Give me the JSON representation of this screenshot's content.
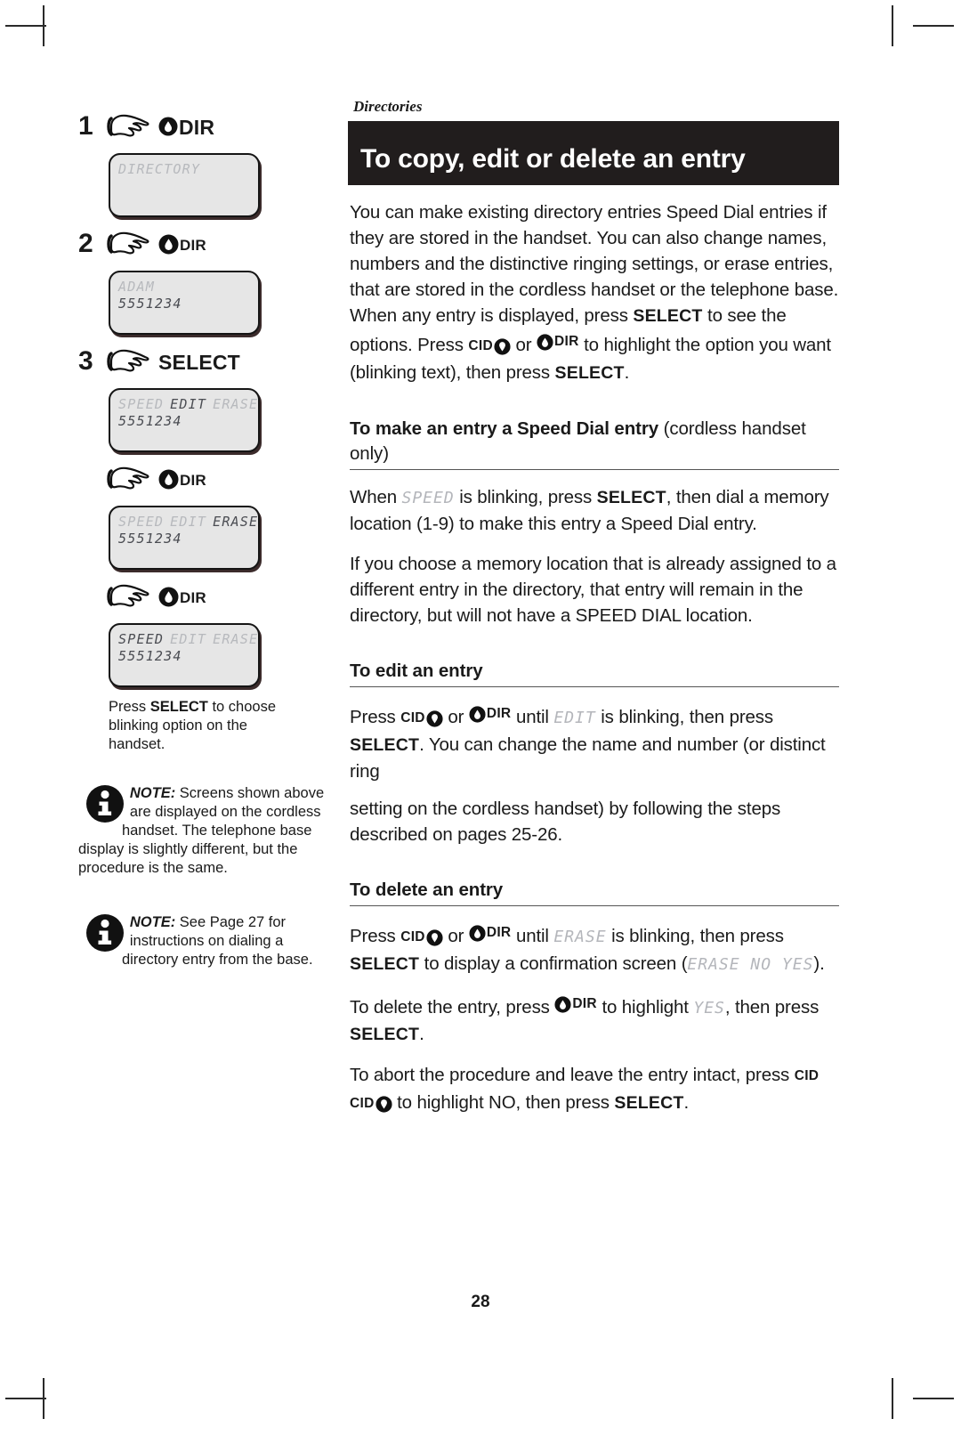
{
  "page": {
    "number": "28",
    "eyebrow": "Directories",
    "title": "To copy, edit or delete an entry"
  },
  "left_column": {
    "steps": [
      {
        "number": "1",
        "key_label": "DIR",
        "key_badge": "up-arrow-badge",
        "badge_size": "large",
        "screen": {
          "lines": [
            "DIRECTORY"
          ]
        }
      },
      {
        "number": "2",
        "key_label": "DIR",
        "key_badge": "up-arrow-badge",
        "badge_size": "small",
        "screen": {
          "lines": [
            "ADAM",
            "5551234"
          ]
        }
      },
      {
        "number": "3",
        "key_label": "SELECT",
        "key_badge": "none",
        "badge_size": "none",
        "screen": {
          "options": [
            "SPEED",
            "EDIT",
            "ERASE"
          ],
          "highlighted": "EDIT",
          "number_line": "5551234"
        }
      },
      {
        "number": "",
        "key_label": "DIR",
        "key_badge": "up-arrow-badge",
        "badge_size": "small",
        "screen": {
          "options": [
            "SPEED",
            "EDIT",
            "ERASE"
          ],
          "highlighted": "ERASE",
          "number_line": "5551234"
        }
      },
      {
        "number": "",
        "key_label": "DIR",
        "key_badge": "up-arrow-badge",
        "badge_size": "small",
        "screen": {
          "options": [
            "SPEED",
            "EDIT",
            "ERASE"
          ],
          "highlighted": "SPEED",
          "number_line": "5551234"
        }
      }
    ],
    "caption": {
      "pre": "Press ",
      "bold": "SELECT",
      "post": " to choose blinking option on the handset."
    },
    "notes": [
      {
        "lead": "NOTE:",
        "text": " Screens shown above are displayed on the cordless handset. The telephone base display is slightly different, but the procedure is the same."
      },
      {
        "lead": "NOTE:",
        "text": " See Page 27 for instructions on dialing a directory entry from the base."
      }
    ]
  },
  "right_column": {
    "intro": {
      "p1_a": "You can make existing directory entries Speed Dial entries if they are stored in the handset. You can also change names, numbers and the distinctive ringing settings, or erase entries, that are stored in the cordless handset or the telephone base. When any entry is displayed, press ",
      "p1_select1": "SELECT",
      "p1_b": " to see the options. Press ",
      "p1_cid": "CID",
      "p1_c": " or ",
      "p1_dir": "DIR",
      "p1_d": " to highlight the option you want (blinking text), then press ",
      "p1_select2": "SELECT",
      "p1_e": "."
    },
    "section_speed": {
      "heading_bold": "To make an entry a Speed Dial entry",
      "heading_light": " (cordless handset only)",
      "p1_a": "When ",
      "p1_seg": "SPEED",
      "p1_b": " is blinking, press ",
      "p1_select": "SELECT",
      "p1_c": ", then dial a memory location (1-9) to make this entry a Speed Dial entry.",
      "p2": "If you choose a memory location that is already assigned to a different entry in the directory, that entry will remain in the directory, but will not have a SPEED DIAL location."
    },
    "section_edit": {
      "heading": "To edit an entry",
      "p1_a": "Press ",
      "p1_cid": "CID",
      "p1_b": " or ",
      "p1_dir": "DIR",
      "p1_c": " until ",
      "p1_seg": "EDIT",
      "p1_d": " is blinking, then press ",
      "p1_select": "SELECT",
      "p1_e": ". You can change the name and number (or distinct ring",
      "p2": "setting on the cordless handset) by following the steps described on pages 25-26."
    },
    "section_delete": {
      "heading": "To delete an entry",
      "p1_a": "Press ",
      "p1_cid": "CID",
      "p1_b": " or ",
      "p1_dir": "DIR",
      "p1_c": " until ",
      "p1_seg": "ERASE",
      "p1_d": " is blinking, then press ",
      "p1_select": "SELECT",
      "p1_e": " to display a confirmation screen (",
      "p1_seg2": "ERASE NO YES",
      "p1_f": ").",
      "p2_a": "To delete the entry, press ",
      "p2_dir": "DIR",
      "p2_b": " to highlight ",
      "p2_seg": "YES",
      "p2_c": ", then press ",
      "p2_select": "SELECT",
      "p2_d": ".",
      "p3_a": "To abort the procedure and leave the entry intact, press ",
      "p3_cid1": "CID",
      "p3_cid2": "CID",
      "p3_b": " to highlight NO, then press ",
      "p3_select": "SELECT",
      "p3_c": "."
    }
  },
  "colors": {
    "title_bar_bg": "#211d1d",
    "lcd_bg": "#e6e6e6",
    "segment_dim": "#b7b9bd",
    "segment_on": "#4a4c52"
  }
}
